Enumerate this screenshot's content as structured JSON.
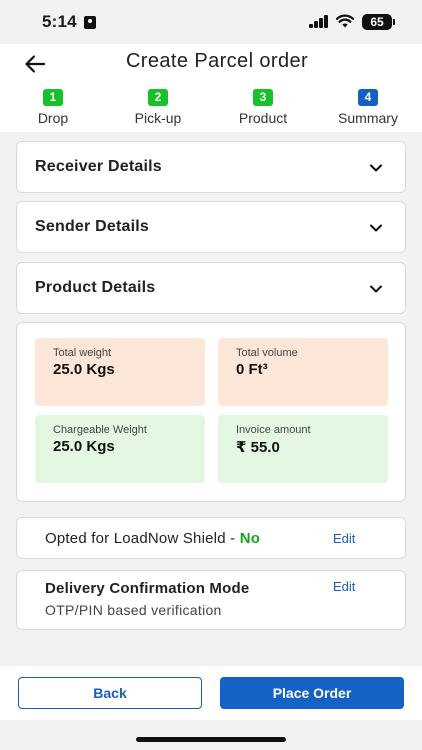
{
  "status_bar": {
    "time": "5:14",
    "battery": "65"
  },
  "header": {
    "title": "Create Parcel order"
  },
  "steps": [
    {
      "number": "1",
      "label": "Drop",
      "color": "#16c12a"
    },
    {
      "number": "2",
      "label": "Pick-up",
      "color": "#16c12a"
    },
    {
      "number": "3",
      "label": "Product",
      "color": "#16c12a"
    },
    {
      "number": "4",
      "label": "Summary",
      "color": "#1560c5"
    }
  ],
  "sections": {
    "receiver": "Receiver Details",
    "sender": "Sender Details",
    "product": "Product Details"
  },
  "summary": {
    "total_weight": {
      "label": "Total weight",
      "value": "25.0 Kgs"
    },
    "total_volume": {
      "label": "Total volume",
      "value": "0 Ft³"
    },
    "chargeable_weight": {
      "label": "Chargeable Weight",
      "value": "25.0 Kgs"
    },
    "invoice_amount": {
      "label": "Invoice amount",
      "value": "₹ 55.0"
    }
  },
  "shield": {
    "text": "Opted for LoadNow Shield - ",
    "value": "No",
    "edit": "Edit"
  },
  "delivery_mode": {
    "title": "Delivery Confirmation Mode",
    "value": "OTP/PIN based verification",
    "edit": "Edit"
  },
  "footer": {
    "back": "Back",
    "place_order": "Place Order"
  }
}
